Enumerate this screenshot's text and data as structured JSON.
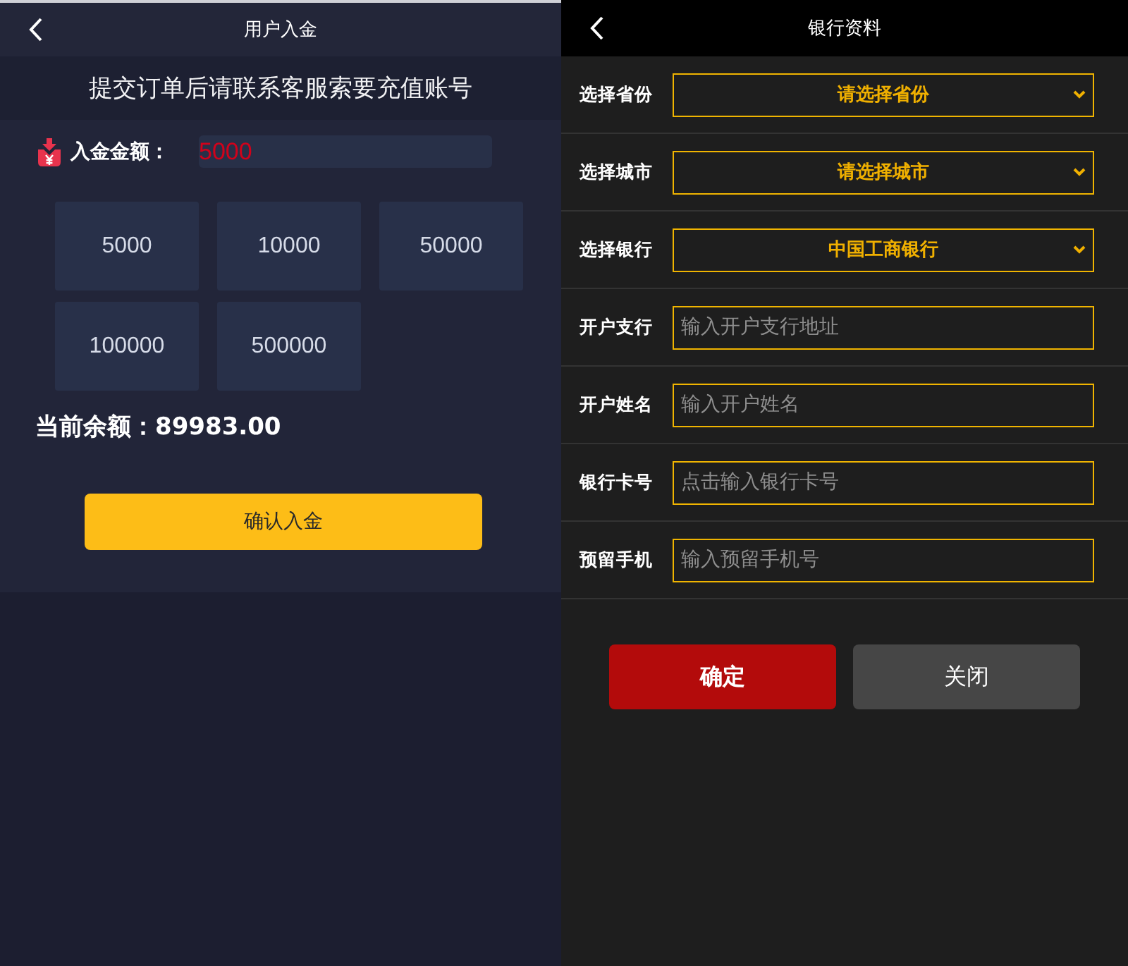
{
  "deposit_screen": {
    "nav_bar": {
      "title": "用户入金"
    },
    "notice": "提交订单后请联系客服索要充值账号",
    "amount_field": {
      "label": "入金金额：",
      "value": "5000"
    },
    "presets": [
      "5000",
      "10000",
      "50000",
      "100000",
      "500000"
    ],
    "balance": "当前余额：89983.00",
    "confirm_button": "确认入金"
  },
  "bank_screen": {
    "nav_bar": {
      "title": "银行资料"
    },
    "fields": [
      {
        "kind": "select",
        "label": "选择省份",
        "value": "请选择省份"
      },
      {
        "kind": "select",
        "label": "选择城市",
        "value": "请选择城市"
      },
      {
        "kind": "select",
        "label": "选择银行",
        "value": "中国工商银行"
      },
      {
        "kind": "input",
        "label": "开户支行",
        "placeholder": "输入开户支行地址"
      },
      {
        "kind": "input",
        "label": "开户姓名",
        "placeholder": "输入开户姓名"
      },
      {
        "kind": "input",
        "label": "银行卡号",
        "placeholder": "点击输入银行卡号"
      },
      {
        "kind": "input",
        "label": "预留手机",
        "placeholder": "输入预留手机号"
      }
    ],
    "buttons": [
      {
        "kind": "primary",
        "label": "确定"
      },
      {
        "kind": "secondary",
        "label": "关闭"
      }
    ]
  }
}
